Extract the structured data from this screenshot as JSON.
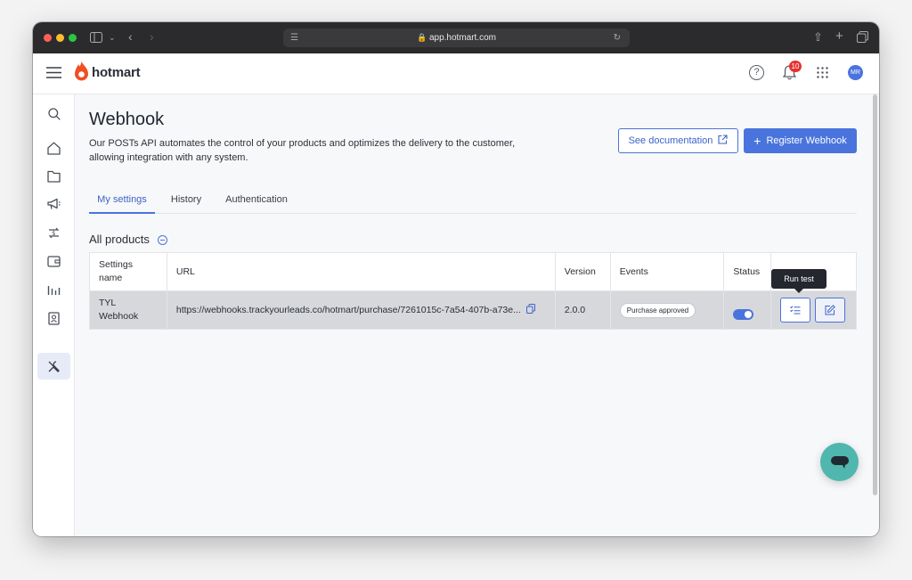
{
  "browser": {
    "url": "app.hotmart.com"
  },
  "topnav": {
    "brand": "hotmart",
    "notification_count": "10",
    "avatar_initials": "MR"
  },
  "page": {
    "title": "Webhook",
    "description_line1": "Our POSTs API automates the control of your products and optimizes the delivery to the customer,",
    "description_line2": "allowing integration with any system.",
    "see_documentation": "See documentation",
    "register_webhook": "Register Webhook"
  },
  "tabs": [
    {
      "label": "My settings",
      "active": true
    },
    {
      "label": "History",
      "active": false
    },
    {
      "label": "Authentication",
      "active": false
    }
  ],
  "section": {
    "title": "All products"
  },
  "table": {
    "headers": {
      "settings_name_1": "Settings",
      "settings_name_2": "name",
      "url": "URL",
      "version": "Version",
      "events": "Events",
      "status": "Status"
    },
    "rows": [
      {
        "name_line1": "TYL",
        "name_line2": "Webhook",
        "url": "https://webhooks.trackyourleads.co/hotmart/purchase/7261015c-7a54-407b-a73e...",
        "version": "2.0.0",
        "event": "Purchase approved",
        "status_on": true
      }
    ]
  },
  "tooltip": {
    "text": "Run test"
  },
  "colors": {
    "brand_orange": "#f04e23",
    "primary_blue": "#4a74dd",
    "chat_teal": "#4fb7ae"
  }
}
